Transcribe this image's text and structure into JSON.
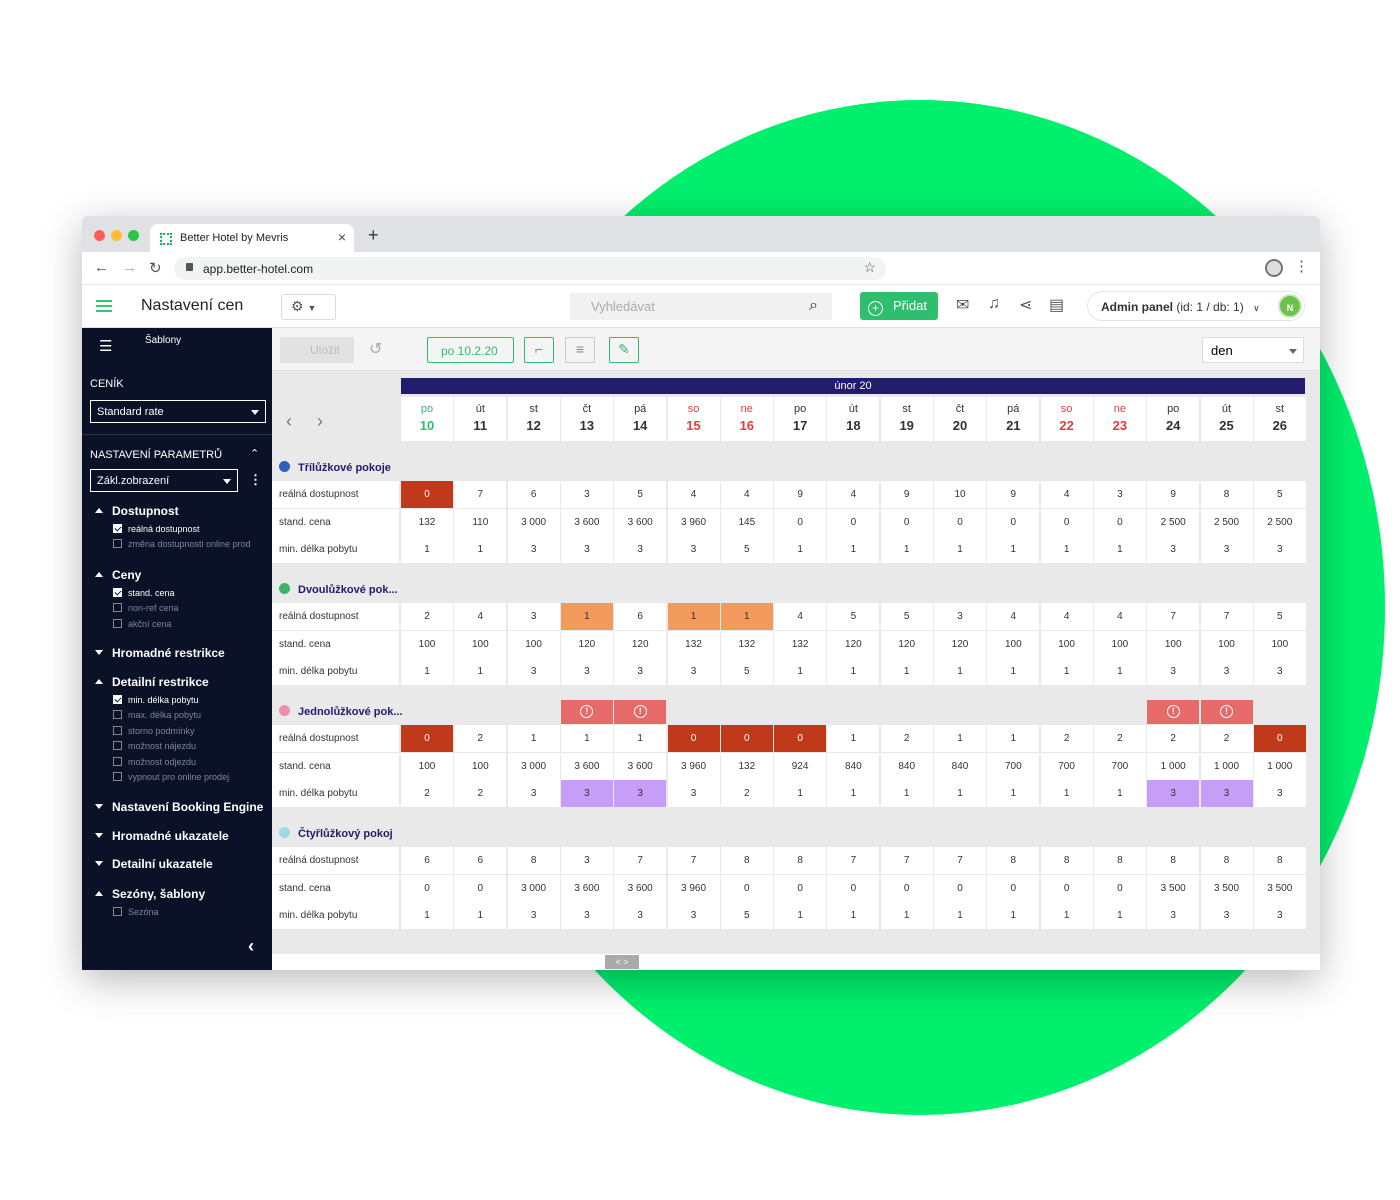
{
  "browser": {
    "tab_title": "Better Hotel by Mevris",
    "url": "app.better-hotel.com"
  },
  "header": {
    "title": "Nastavení cen",
    "search_placeholder": "Vyhledávat",
    "add_label": "Přidat",
    "admin_label": "Admin panel",
    "admin_detail": " (id: 1 / db: 1)",
    "avatar": "N"
  },
  "sidebar": {
    "templates": "Šablony",
    "pricelist_label": "CENÍK",
    "pricelist_value": "Standard rate",
    "params_label": "NASTAVENÍ PARAMETRŮ",
    "params_value": "Zákl.zobrazení",
    "groups": [
      {
        "label": "Dostupnost",
        "open": true,
        "items": [
          {
            "label": "reálná dostupnost",
            "checked": true
          },
          {
            "label": "změna dostupnosti online prod",
            "checked": false
          }
        ]
      },
      {
        "label": "Ceny",
        "open": true,
        "items": [
          {
            "label": "stand. cena",
            "checked": true
          },
          {
            "label": "non-ref cena",
            "checked": false
          },
          {
            "label": "akční cena",
            "checked": false
          }
        ]
      },
      {
        "label": "Hromadné restrikce",
        "open": false,
        "items": []
      },
      {
        "label": "Detailní restrikce",
        "open": true,
        "items": [
          {
            "label": "min. délka pobytu",
            "checked": true
          },
          {
            "label": "max. délka pobytu",
            "checked": false
          },
          {
            "label": "storno podmínky",
            "checked": false
          },
          {
            "label": "možnost nájezdu",
            "checked": false
          },
          {
            "label": "možnost odjezdu",
            "checked": false
          },
          {
            "label": "vypnout pro online prodej",
            "checked": false
          }
        ]
      },
      {
        "label": "Nastavení Booking Engine",
        "open": false,
        "items": []
      },
      {
        "label": "Hromadné ukazatele",
        "open": false,
        "items": []
      },
      {
        "label": "Detailní ukazatele",
        "open": false,
        "items": []
      },
      {
        "label": "Sezóny, šablony",
        "open": true,
        "items": [
          {
            "label": "Sezóna",
            "checked": false
          }
        ]
      }
    ]
  },
  "toolbar": {
    "save_label": "Uložit",
    "date_label": "po 10.2.20",
    "view_value": "den"
  },
  "calendar": {
    "month": "únor 20",
    "days": [
      {
        "dn": "po",
        "dd": "10",
        "kind": "green"
      },
      {
        "dn": "út",
        "dd": "11",
        "kind": ""
      },
      {
        "dn": "st",
        "dd": "12",
        "kind": ""
      },
      {
        "dn": "čt",
        "dd": "13",
        "kind": ""
      },
      {
        "dn": "pá",
        "dd": "14",
        "kind": ""
      },
      {
        "dn": "so",
        "dd": "15",
        "kind": "red"
      },
      {
        "dn": "ne",
        "dd": "16",
        "kind": "red"
      },
      {
        "dn": "po",
        "dd": "17",
        "kind": ""
      },
      {
        "dn": "út",
        "dd": "18",
        "kind": ""
      },
      {
        "dn": "st",
        "dd": "19",
        "kind": ""
      },
      {
        "dn": "čt",
        "dd": "20",
        "kind": ""
      },
      {
        "dn": "pá",
        "dd": "21",
        "kind": ""
      },
      {
        "dn": "so",
        "dd": "22",
        "kind": "red"
      },
      {
        "dn": "ne",
        "dd": "23",
        "kind": "red"
      },
      {
        "dn": "po",
        "dd": "24",
        "kind": ""
      },
      {
        "dn": "út",
        "dd": "25",
        "kind": ""
      },
      {
        "dn": "st",
        "dd": "26",
        "kind": ""
      }
    ],
    "rooms": [
      {
        "name": "Třílůžkové pokoje",
        "color": "#2d5fbf",
        "warnings": [],
        "rows": [
          {
            "label": "reálná dostupnost",
            "values": [
              "0",
              "7",
              "6",
              "3",
              "5",
              "4",
              "4",
              "9",
              "4",
              "9",
              "10",
              "9",
              "4",
              "3",
              "9",
              "8",
              "5"
            ],
            "marks": {
              "0": "red"
            }
          },
          {
            "label": "stand. cena",
            "values": [
              "132",
              "110",
              "3 000",
              "3 600",
              "3 600",
              "3 960",
              "145",
              "0",
              "0",
              "0",
              "0",
              "0",
              "0",
              "0",
              "2 500",
              "2 500",
              "2 500"
            ],
            "marks": {}
          },
          {
            "label": "min. délka pobytu",
            "values": [
              "1",
              "1",
              "3",
              "3",
              "3",
              "3",
              "5",
              "1",
              "1",
              "1",
              "1",
              "1",
              "1",
              "1",
              "3",
              "3",
              "3"
            ],
            "marks": {}
          }
        ]
      },
      {
        "name": "Dvoulůžkové pok...",
        "color": "#3db36a",
        "warnings": [],
        "rows": [
          {
            "label": "reálná dostupnost",
            "values": [
              "2",
              "4",
              "3",
              "1",
              "6",
              "1",
              "1",
              "4",
              "5",
              "5",
              "3",
              "4",
              "4",
              "4",
              "7",
              "7",
              "5"
            ],
            "marks": {
              "3": "org",
              "5": "org",
              "6": "org"
            }
          },
          {
            "label": "stand. cena",
            "values": [
              "100",
              "100",
              "100",
              "120",
              "120",
              "132",
              "132",
              "132",
              "120",
              "120",
              "120",
              "100",
              "100",
              "100",
              "100",
              "100",
              "100"
            ],
            "marks": {}
          },
          {
            "label": "min. délka pobytu",
            "values": [
              "1",
              "1",
              "3",
              "3",
              "3",
              "3",
              "5",
              "1",
              "1",
              "1",
              "1",
              "1",
              "1",
              "1",
              "3",
              "3",
              "3"
            ],
            "marks": {}
          }
        ]
      },
      {
        "name": "Jednolůžkové pok...",
        "color": "#f08cb0",
        "warnings": [
          3,
          4,
          14,
          15
        ],
        "rows": [
          {
            "label": "reálná dostupnost",
            "values": [
              "0",
              "2",
              "1",
              "1",
              "1",
              "0",
              "0",
              "0",
              "1",
              "2",
              "1",
              "1",
              "2",
              "2",
              "2",
              "2",
              "0"
            ],
            "marks": {
              "0": "red",
              "5": "red",
              "6": "red",
              "7": "red",
              "16": "red"
            }
          },
          {
            "label": "stand. cena",
            "values": [
              "100",
              "100",
              "3 000",
              "3 600",
              "3 600",
              "3 960",
              "132",
              "924",
              "840",
              "840",
              "840",
              "700",
              "700",
              "700",
              "1 000",
              "1 000",
              "1 000"
            ],
            "marks": {}
          },
          {
            "label": "min. délka pobytu",
            "values": [
              "2",
              "2",
              "3",
              "3",
              "3",
              "3",
              "2",
              "1",
              "1",
              "1",
              "1",
              "1",
              "1",
              "1",
              "3",
              "3",
              "3"
            ],
            "marks": {
              "3": "pur",
              "4": "pur",
              "14": "pur",
              "15": "pur"
            }
          }
        ]
      },
      {
        "name": "Čtyřlůžkový pokoj",
        "color": "#9ed9e6",
        "warnings": [],
        "rows": [
          {
            "label": "reálná dostupnost",
            "values": [
              "6",
              "6",
              "8",
              "3",
              "7",
              "7",
              "8",
              "8",
              "7",
              "7",
              "7",
              "8",
              "8",
              "8",
              "8",
              "8",
              "8"
            ],
            "marks": {}
          },
          {
            "label": "stand. cena",
            "values": [
              "0",
              "0",
              "3 000",
              "3 600",
              "3 600",
              "3 960",
              "0",
              "0",
              "0",
              "0",
              "0",
              "0",
              "0",
              "0",
              "3 500",
              "3 500",
              "3 500"
            ],
            "marks": {}
          },
          {
            "label": "min. délka pobytu",
            "values": [
              "1",
              "1",
              "3",
              "3",
              "3",
              "3",
              "5",
              "1",
              "1",
              "1",
              "1",
              "1",
              "1",
              "1",
              "3",
              "3",
              "3"
            ],
            "marks": {}
          }
        ]
      }
    ]
  },
  "scroll_handle": "< >"
}
